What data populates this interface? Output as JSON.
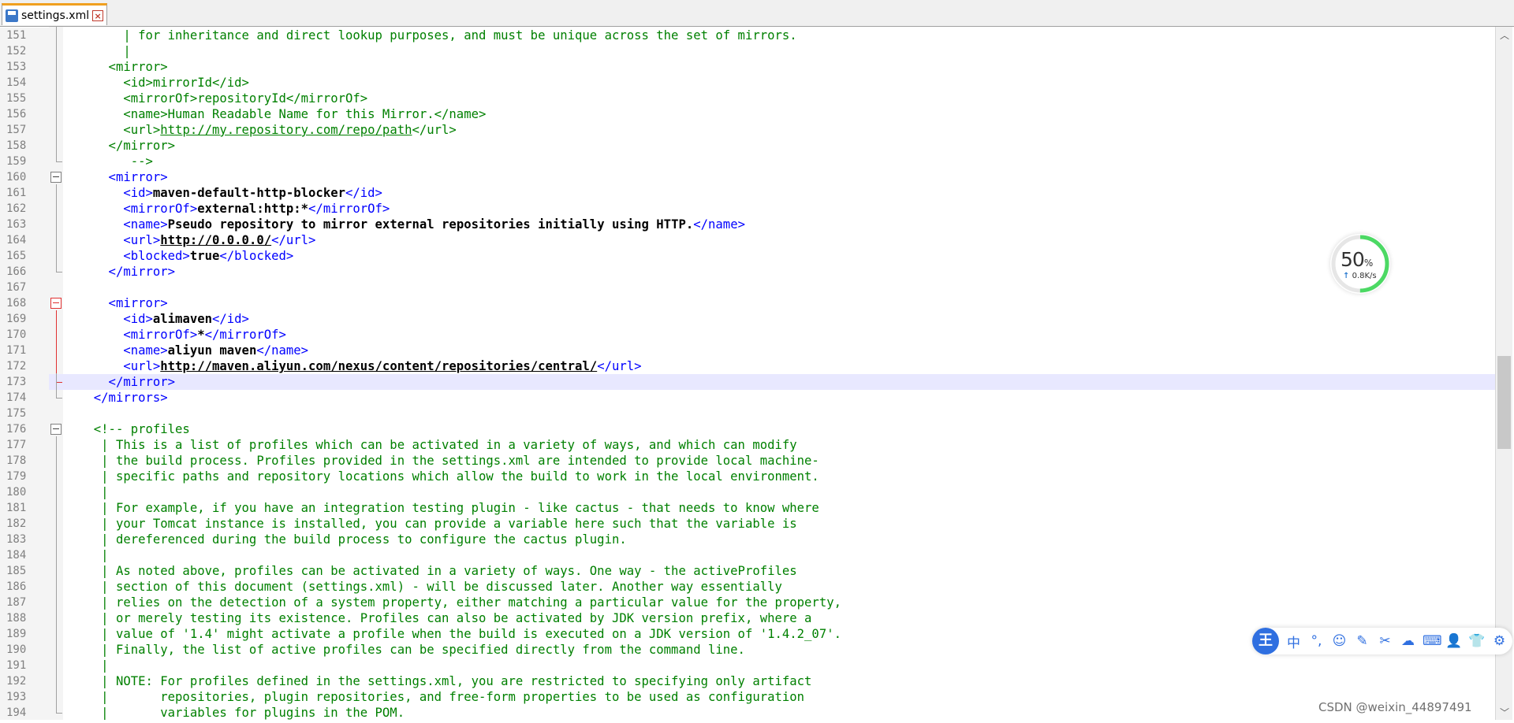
{
  "tab": {
    "title": "settings.xml"
  },
  "lines": [
    {
      "num": "151",
      "parts": [
        {
          "c": "c",
          "t": "      | for inheritance and direct lookup purposes, and must be unique across the set of mirrors."
        }
      ]
    },
    {
      "num": "152",
      "parts": [
        {
          "c": "c",
          "t": "      |"
        }
      ]
    },
    {
      "num": "153",
      "parts": [
        {
          "c": "c",
          "t": "    <mirror>"
        }
      ]
    },
    {
      "num": "154",
      "parts": [
        {
          "c": "c",
          "t": "      <id>mirrorId</id>"
        }
      ]
    },
    {
      "num": "155",
      "parts": [
        {
          "c": "c",
          "t": "      <mirrorOf>repositoryId</mirrorOf>"
        }
      ]
    },
    {
      "num": "156",
      "parts": [
        {
          "c": "c",
          "t": "      <name>Human Readable Name for this Mirror.</name>"
        }
      ]
    },
    {
      "num": "157",
      "parts": [
        {
          "c": "c",
          "t": "      <url>"
        },
        {
          "c": "c u",
          "t": "http://my.repository.com/repo/path"
        },
        {
          "c": "c",
          "t": "</url>"
        }
      ]
    },
    {
      "num": "158",
      "parts": [
        {
          "c": "c",
          "t": "    </mirror>"
        }
      ]
    },
    {
      "num": "159",
      "parts": [
        {
          "c": "c",
          "t": "       -->"
        }
      ]
    },
    {
      "num": "160",
      "parts": [
        {
          "c": "t",
          "t": "    <mirror>"
        }
      ]
    },
    {
      "num": "161",
      "parts": [
        {
          "c": "t",
          "t": "      <id>"
        },
        {
          "c": "b",
          "t": "maven-default-http-blocker"
        },
        {
          "c": "t",
          "t": "</id>"
        }
      ]
    },
    {
      "num": "162",
      "parts": [
        {
          "c": "t",
          "t": "      <mirrorOf>"
        },
        {
          "c": "b",
          "t": "external:http:*"
        },
        {
          "c": "t",
          "t": "</mirrorOf>"
        }
      ]
    },
    {
      "num": "163",
      "parts": [
        {
          "c": "t",
          "t": "      <name>"
        },
        {
          "c": "b",
          "t": "Pseudo repository to mirror external repositories initially using HTTP."
        },
        {
          "c": "t",
          "t": "</name>"
        }
      ]
    },
    {
      "num": "164",
      "parts": [
        {
          "c": "t",
          "t": "      <url>"
        },
        {
          "c": "b u",
          "t": "http://0.0.0.0/"
        },
        {
          "c": "t",
          "t": "</url>"
        }
      ]
    },
    {
      "num": "165",
      "parts": [
        {
          "c": "t",
          "t": "      <blocked>"
        },
        {
          "c": "b",
          "t": "true"
        },
        {
          "c": "t",
          "t": "</blocked>"
        }
      ]
    },
    {
      "num": "166",
      "parts": [
        {
          "c": "t",
          "t": "    </mirror>"
        }
      ]
    },
    {
      "num": "167",
      "parts": [
        {
          "c": "",
          "t": ""
        }
      ]
    },
    {
      "num": "168",
      "parts": [
        {
          "c": "t",
          "t": "    <mirror>"
        }
      ]
    },
    {
      "num": "169",
      "parts": [
        {
          "c": "t",
          "t": "      <id>"
        },
        {
          "c": "b",
          "t": "alimaven"
        },
        {
          "c": "t",
          "t": "</id>"
        }
      ]
    },
    {
      "num": "170",
      "parts": [
        {
          "c": "t",
          "t": "      <mirrorOf>"
        },
        {
          "c": "b",
          "t": "*"
        },
        {
          "c": "t",
          "t": "</mirrorOf>"
        }
      ]
    },
    {
      "num": "171",
      "parts": [
        {
          "c": "t",
          "t": "      <name>"
        },
        {
          "c": "b",
          "t": "aliyun maven"
        },
        {
          "c": "t",
          "t": "</name>"
        }
      ]
    },
    {
      "num": "172",
      "parts": [
        {
          "c": "t",
          "t": "      <url>"
        },
        {
          "c": "b u",
          "t": "http://maven.aliyun.com/nexus/content/repositories/central/"
        },
        {
          "c": "t",
          "t": "</url>"
        }
      ]
    },
    {
      "num": "173",
      "current": true,
      "parts": [
        {
          "c": "t",
          "t": "    </mirror>"
        }
      ]
    },
    {
      "num": "174",
      "parts": [
        {
          "c": "t",
          "t": "  </mirrors>"
        }
      ]
    },
    {
      "num": "175",
      "parts": [
        {
          "c": "",
          "t": ""
        }
      ]
    },
    {
      "num": "176",
      "parts": [
        {
          "c": "c",
          "t": "  <!-- profiles"
        }
      ]
    },
    {
      "num": "177",
      "parts": [
        {
          "c": "c",
          "t": "   | This is a list of profiles which can be activated in a variety of ways, and which can modify"
        }
      ]
    },
    {
      "num": "178",
      "parts": [
        {
          "c": "c",
          "t": "   | the build process. Profiles provided in the settings.xml are intended to provide local machine-"
        }
      ]
    },
    {
      "num": "179",
      "parts": [
        {
          "c": "c",
          "t": "   | specific paths and repository locations which allow the build to work in the local environment."
        }
      ]
    },
    {
      "num": "180",
      "parts": [
        {
          "c": "c",
          "t": "   |"
        }
      ]
    },
    {
      "num": "181",
      "parts": [
        {
          "c": "c",
          "t": "   | For example, if you have an integration testing plugin - like cactus - that needs to know where"
        }
      ]
    },
    {
      "num": "182",
      "parts": [
        {
          "c": "c",
          "t": "   | your Tomcat instance is installed, you can provide a variable here such that the variable is"
        }
      ]
    },
    {
      "num": "183",
      "parts": [
        {
          "c": "c",
          "t": "   | dereferenced during the build process to configure the cactus plugin."
        }
      ]
    },
    {
      "num": "184",
      "parts": [
        {
          "c": "c",
          "t": "   |"
        }
      ]
    },
    {
      "num": "185",
      "parts": [
        {
          "c": "c",
          "t": "   | As noted above, profiles can be activated in a variety of ways. One way - the activeProfiles"
        }
      ]
    },
    {
      "num": "186",
      "parts": [
        {
          "c": "c",
          "t": "   | section of this document (settings.xml) - will be discussed later. Another way essentially"
        }
      ]
    },
    {
      "num": "187",
      "parts": [
        {
          "c": "c",
          "t": "   | relies on the detection of a system property, either matching a particular value for the property,"
        }
      ]
    },
    {
      "num": "188",
      "parts": [
        {
          "c": "c",
          "t": "   | or merely testing its existence. Profiles can also be activated by JDK version prefix, where a"
        }
      ]
    },
    {
      "num": "189",
      "parts": [
        {
          "c": "c",
          "t": "   | value of '1.4' might activate a profile when the build is executed on a JDK version of '1.4.2_07'."
        }
      ]
    },
    {
      "num": "190",
      "parts": [
        {
          "c": "c",
          "t": "   | Finally, the list of active profiles can be specified directly from the command line."
        }
      ]
    },
    {
      "num": "191",
      "parts": [
        {
          "c": "c",
          "t": "   |"
        }
      ]
    },
    {
      "num": "192",
      "parts": [
        {
          "c": "c",
          "t": "   | NOTE: For profiles defined in the settings.xml, you are restricted to specifying only artifact"
        }
      ]
    },
    {
      "num": "193",
      "parts": [
        {
          "c": "c",
          "t": "   |       repositories, plugin repositories, and free-form properties to be used as configuration"
        }
      ]
    },
    {
      "num": "194",
      "parts": [
        {
          "c": "c",
          "t": "   |       variables for plugins in the POM."
        }
      ]
    }
  ],
  "net_widget": {
    "percent": "50",
    "percent_sign": "%",
    "speed": "0.8K/s",
    "progress": 0.5,
    "color": "#4cd964"
  },
  "ime_toolbar": {
    "logo": "王",
    "icons": [
      {
        "name": "chinese-mode-icon",
        "glyph": "中"
      },
      {
        "name": "punctuation-icon",
        "glyph": "°,"
      },
      {
        "name": "emoji-icon",
        "glyph": "☺"
      },
      {
        "name": "handwriting-icon",
        "glyph": "✎"
      },
      {
        "name": "scissors-icon",
        "glyph": "✂"
      },
      {
        "name": "cloud-icon",
        "glyph": "☁"
      },
      {
        "name": "keyboard-icon",
        "glyph": "⌨"
      },
      {
        "name": "user-icon",
        "glyph": "👤"
      },
      {
        "name": "skin-icon",
        "glyph": "👕"
      },
      {
        "name": "settings-icon",
        "glyph": "⚙"
      }
    ]
  },
  "watermark": "CSDN @weixin_44897491"
}
